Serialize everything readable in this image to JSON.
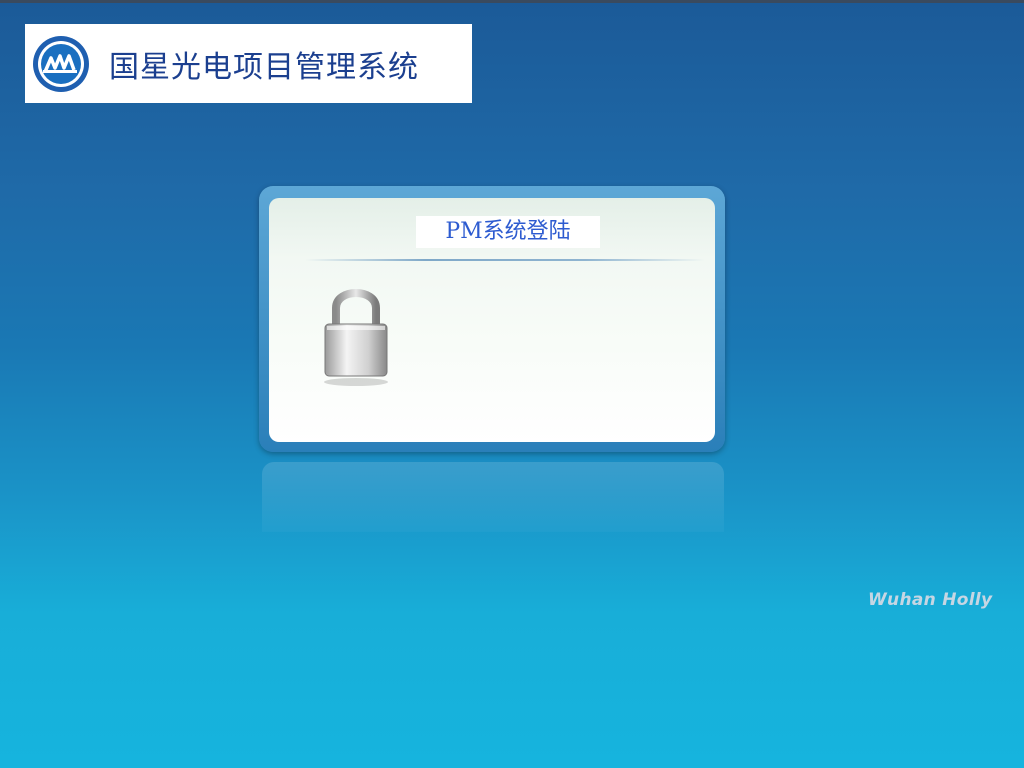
{
  "header": {
    "logo_icon": "company-logo-icon",
    "system_title": "国星光电项目管理系统"
  },
  "login_card": {
    "title": "PM系统登陆",
    "icon": "padlock-icon"
  },
  "footer": {
    "brand": "Wuhan Holly"
  },
  "colors": {
    "title_blue": "#2d5bd0",
    "logo_title_blue": "#1b3f8f"
  }
}
